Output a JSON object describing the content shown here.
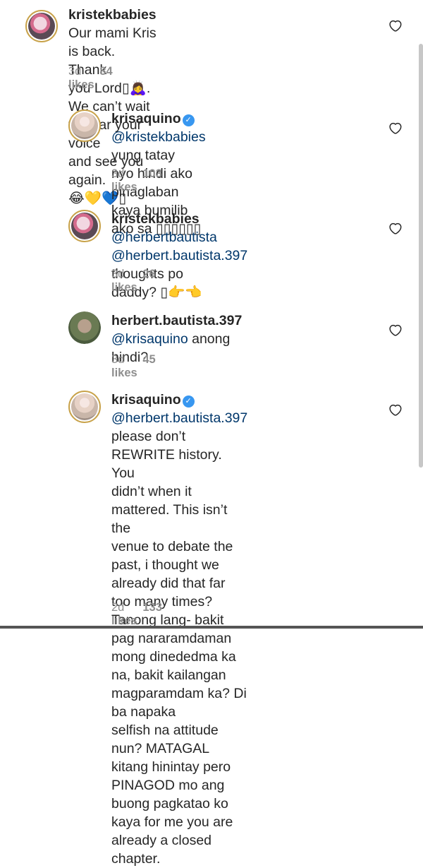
{
  "comments": [
    {
      "username": "kristekbabies",
      "line1": " Our mami Kris is back. Thank",
      "line2": "you Lord",
      "line2_emoji": "▯🙇‍♀️",
      "line2_rest": ". We can’t wait to hear your voice",
      "line3": "and see you again.",
      "line3_emoji": "😂💛💙▯",
      "time": "3d",
      "likes": "84 likes"
    },
    {
      "username": "krisaquino",
      "mention": "@kristekbabies",
      "line1_rest": " yung tatay",
      "line2": "nyo hindi ako pinaglaban kaya bumilib",
      "line3": "ako sa ▯▯▯▯▯▯",
      "time": "3d",
      "likes": "103 likes"
    },
    {
      "username": "kristekbabies",
      "mention": "@herbertbautista",
      "line2_mention": "@herbert.bautista.397",
      "line2_rest": " thoughts po",
      "line3": "daddy? ▯",
      "line3_emoji": "👉👈",
      "time": "3d",
      "likes": "26 likes"
    },
    {
      "username": "herbert.bautista.397",
      "mention": "@krisaquino",
      "line1_rest": " anong",
      "line2": "hindi?",
      "time": "3d",
      "likes": "45 likes"
    },
    {
      "username": "krisaquino",
      "mention": "@herbert.bautista.397",
      "lines": [
        "please don’t REWRITE history. You",
        "didn’t when it mattered. This isn’t the",
        "venue to debate the past, i thought we",
        "already did that far too many times?",
        "Tanong lang- bakit pag nararamdaman",
        "mong dinededma ka na, bakit kailangan",
        "magparamdam ka? Di ba napaka",
        "selfish na attitude nun? MATAGAL",
        "kitang hinintay pero PINAGOD mo ang",
        "buong pagkatao ko kaya for me you are",
        "already a closed chapter."
      ],
      "time": "2d",
      "likes": "133 likes"
    }
  ],
  "icons": {
    "like": "heart-outline-icon",
    "verified": "verified-check-icon",
    "verified_glyph": "✓"
  },
  "colors": {
    "text": "#262626",
    "mention": "#00376b",
    "meta": "#8e8e8e",
    "verified": "#3897f0"
  }
}
